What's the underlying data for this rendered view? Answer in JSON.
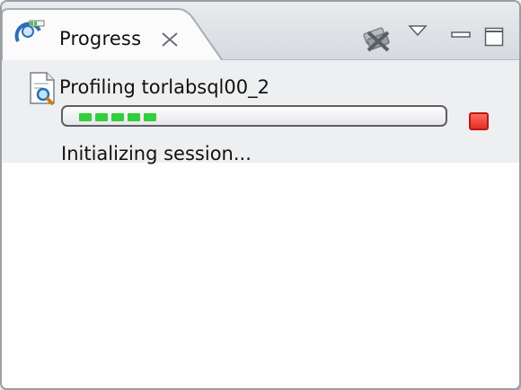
{
  "tab": {
    "title": "Progress"
  },
  "job": {
    "name": "Profiling torlabsql00_2",
    "status": "Initializing session...",
    "progress_chunks": 5
  },
  "icons": {
    "view_icon": "progress-view-icon",
    "close": "close-tab-icon",
    "remove_all": "remove-all-finished-icon",
    "menu": "view-menu-icon",
    "minimize": "minimize-icon",
    "maximize": "maximize-icon",
    "job_icon": "profile-document-icon",
    "cancel": "cancel-stop-icon"
  },
  "colors": {
    "progress": "#2fd03a",
    "cancel": "#e42d24"
  }
}
